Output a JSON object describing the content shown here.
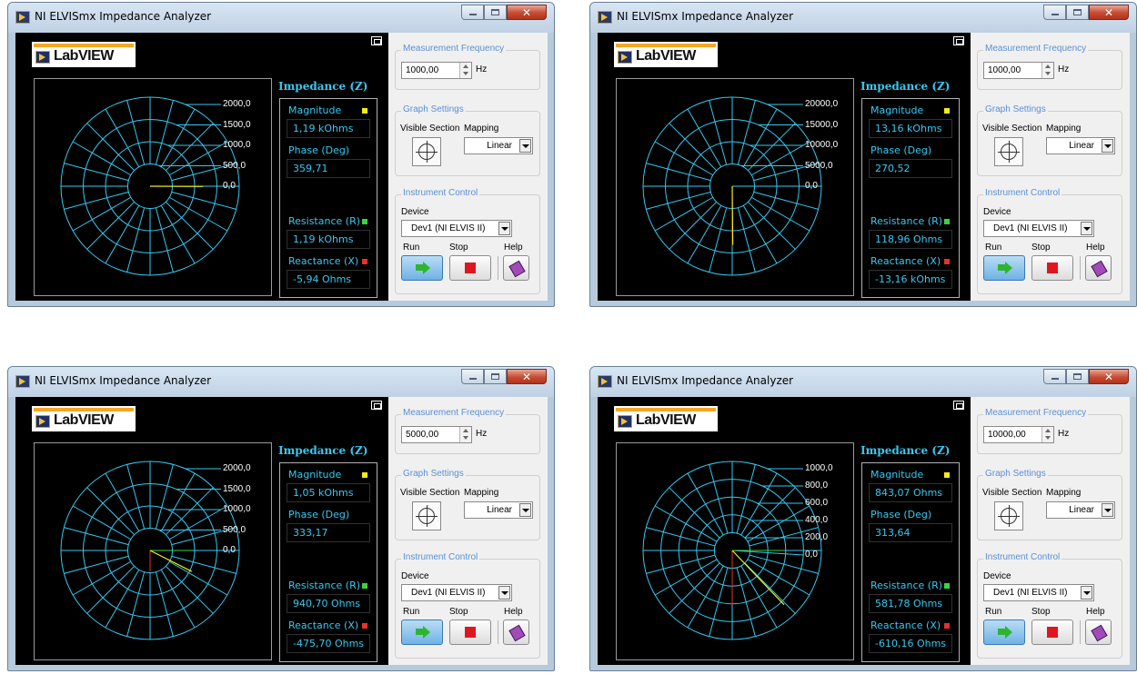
{
  "colors": {
    "window_frame": "#b7cadc",
    "panel_bg": "#000000",
    "grid_color": "#38c8f0",
    "label_cyan": "#38c8f0",
    "group_title": "#5a90d6",
    "led_magnitude": "#f4ec1a",
    "led_resistance": "#3cd43c",
    "led_reactance": "#e8302c"
  },
  "icons": [
    "labview-app-icon",
    "minimize-icon",
    "maximize-icon",
    "close-icon",
    "window-resize-icon",
    "crosshair-icon",
    "run-arrow-icon",
    "stop-square-icon",
    "help-book-icon"
  ],
  "windows": [
    {
      "title": "NI ELVISmx Impedance Analyzer",
      "logo_text": "LabVIEW",
      "impedance_title": "Impedance (Z)",
      "graph": {
        "scale_labels": [
          "2000,0",
          "1500,0",
          "1000,0",
          "500,0",
          "0,0"
        ],
        "max": 2000,
        "magnitude": 1190,
        "phase_deg": 359.71
      },
      "magnitude_label": "Magnitude",
      "magnitude_value": "1,19 kOhms",
      "phase_label": "Phase (Deg)",
      "phase_value": "359,71",
      "resistance_label": "Resistance (R)",
      "resistance_value": "1,19 kOhms",
      "reactance_label": "Reactance (X)",
      "reactance_value": "-5,94 Ohms",
      "freq_group": "Measurement Frequency",
      "frequency": "1000,00",
      "freq_unit": "Hz",
      "graph_group": "Graph Settings",
      "visible_section_label": "Visible Section",
      "mapping_label": "Mapping",
      "mapping": "Linear",
      "instr_group": "Instrument Control",
      "device_label": "Device",
      "device": "Dev1 (NI ELVIS II)",
      "run_label": "Run",
      "stop_label": "Stop",
      "help_label": "Help"
    },
    {
      "title": "NI ELVISmx Impedance Analyzer",
      "logo_text": "LabVIEW",
      "impedance_title": "Impedance (Z)",
      "graph": {
        "scale_labels": [
          "20000,0",
          "15000,0",
          "10000,0",
          "5000,0",
          "0,0"
        ],
        "max": 20000,
        "magnitude": 13160,
        "phase_deg": 270.52
      },
      "magnitude_label": "Magnitude",
      "magnitude_value": "13,16 kOhms",
      "phase_label": "Phase (Deg)",
      "phase_value": "270,52",
      "resistance_label": "Resistance (R)",
      "resistance_value": "118,96 Ohms",
      "reactance_label": "Reactance (X)",
      "reactance_value": "-13,16 kOhms",
      "freq_group": "Measurement Frequency",
      "frequency": "1000,00",
      "freq_unit": "Hz",
      "graph_group": "Graph Settings",
      "visible_section_label": "Visible Section",
      "mapping_label": "Mapping",
      "mapping": "Linear",
      "instr_group": "Instrument Control",
      "device_label": "Device",
      "device": "Dev1 (NI ELVIS II)",
      "run_label": "Run",
      "stop_label": "Stop",
      "help_label": "Help"
    },
    {
      "title": "NI ELVISmx Impedance Analyzer",
      "logo_text": "LabVIEW",
      "impedance_title": "Impedance (Z)",
      "graph": {
        "scale_labels": [
          "2000,0",
          "1500,0",
          "1000,0",
          "500,0",
          "0,0"
        ],
        "max": 2000,
        "magnitude": 1050,
        "phase_deg": 333.17
      },
      "magnitude_label": "Magnitude",
      "magnitude_value": "1,05 kOhms",
      "phase_label": "Phase (Deg)",
      "phase_value": "333,17",
      "resistance_label": "Resistance (R)",
      "resistance_value": "940,70 Ohms",
      "reactance_label": "Reactance (X)",
      "reactance_value": "-475,70 Ohms",
      "freq_group": "Measurement Frequency",
      "frequency": "5000,00",
      "freq_unit": "Hz",
      "graph_group": "Graph Settings",
      "visible_section_label": "Visible Section",
      "mapping_label": "Mapping",
      "mapping": "Linear",
      "instr_group": "Instrument Control",
      "device_label": "Device",
      "device": "Dev1 (NI ELVIS II)",
      "run_label": "Run",
      "stop_label": "Stop",
      "help_label": "Help"
    },
    {
      "title": "NI ELVISmx Impedance Analyzer",
      "logo_text": "LabVIEW",
      "impedance_title": "Impedance (Z)",
      "graph": {
        "scale_labels": [
          "1000,0",
          "800,0",
          "600,0",
          "400,0",
          "200,0",
          "0,0"
        ],
        "max": 1000,
        "magnitude": 843.07,
        "phase_deg": 313.64
      },
      "magnitude_label": "Magnitude",
      "magnitude_value": "843,07 Ohms",
      "phase_label": "Phase (Deg)",
      "phase_value": "313,64",
      "resistance_label": "Resistance (R)",
      "resistance_value": "581,78 Ohms",
      "reactance_label": "Reactance (X)",
      "reactance_value": "-610,16 Ohms",
      "freq_group": "Measurement Frequency",
      "frequency": "10000,00",
      "freq_unit": "Hz",
      "graph_group": "Graph Settings",
      "visible_section_label": "Visible Section",
      "mapping_label": "Mapping",
      "mapping": "Linear",
      "instr_group": "Instrument Control",
      "device_label": "Device",
      "device": "Dev1 (NI ELVIS II)",
      "run_label": "Run",
      "stop_label": "Stop",
      "help_label": "Help"
    }
  ]
}
